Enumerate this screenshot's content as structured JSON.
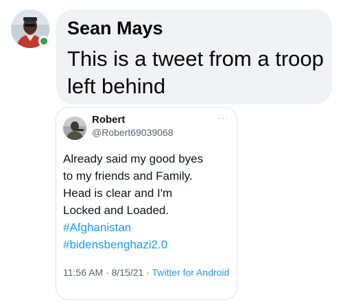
{
  "comment": {
    "author": "Sean Mays",
    "text": "This is a tweet from a troop left behind"
  },
  "tweet": {
    "name": "Robert",
    "handle": "@Robert69039068",
    "more": "···",
    "lines": [
      "Already said my good byes",
      "to my friends and Family.",
      "Head is clear and I'm",
      "Locked and Loaded."
    ],
    "hashtags": [
      "#Afghanistan",
      "#bidensbenghazi2.0"
    ],
    "time": "11:56 AM",
    "date": "8/15/21",
    "source": "Twitter for Android",
    "separator": " · "
  },
  "colors": {
    "bubble": "#f0f2f5",
    "link": "#1d9bf0",
    "online": "#31a24c"
  }
}
